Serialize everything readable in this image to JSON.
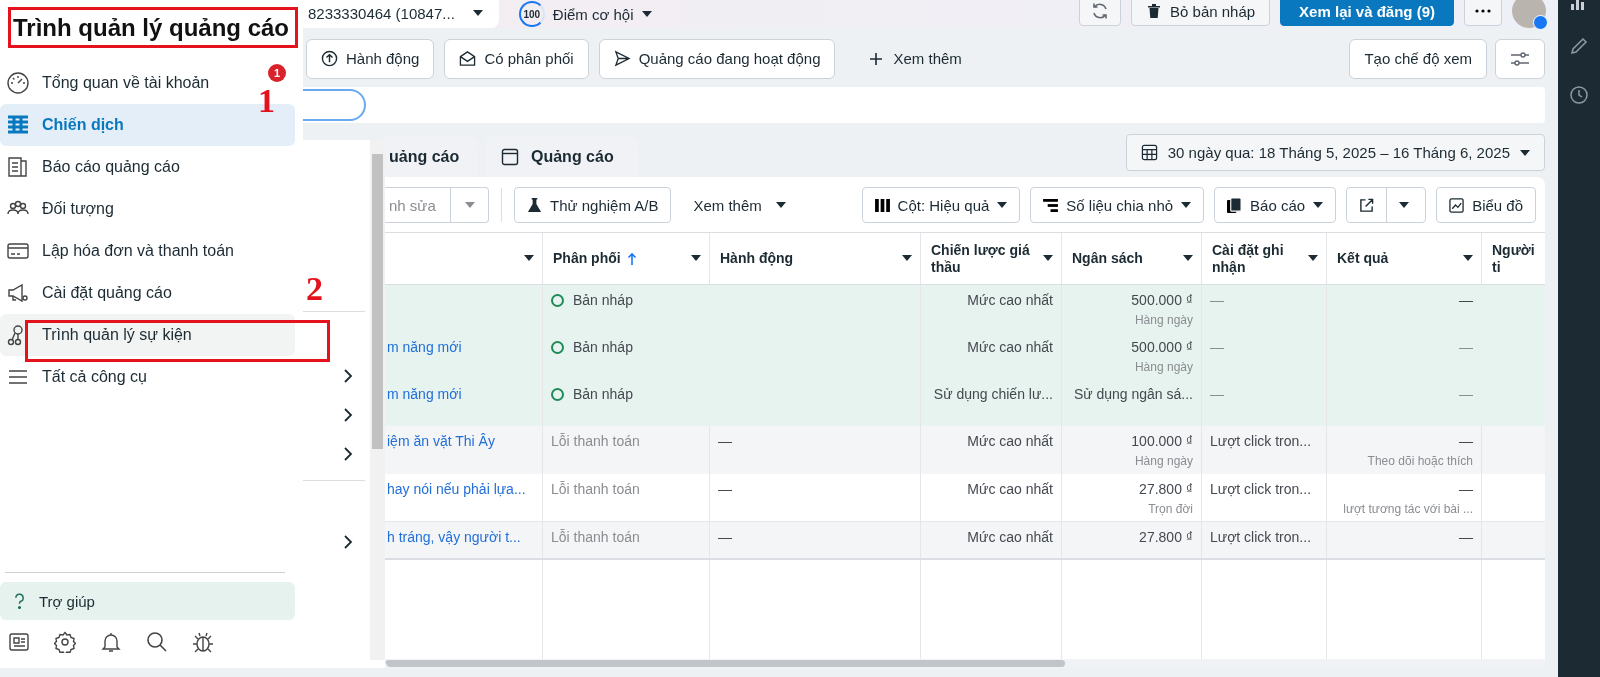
{
  "top_bar": {
    "account": "8233330464 (10847...",
    "score": "100",
    "opportunity": "Điểm cơ hội",
    "discard": "Bỏ bản nháp",
    "publish": "Xem lại và đăng (9)"
  },
  "filters": [
    {
      "label": "Hành động"
    },
    {
      "label": "Có phân phối"
    },
    {
      "label": "Quảng cáo đang hoạt động"
    }
  ],
  "more_filters": "Xem thêm",
  "create_view": "Tạo chế độ xem",
  "tabs": [
    {
      "label": "uảng cáo",
      "selected": false
    },
    {
      "label": "Quảng cáo",
      "selected": false
    }
  ],
  "date_range": "30 ngày qua: 18 Tháng 5, 2025 – 16 Tháng 6, 2025",
  "toolbar": {
    "edit": "nh sửa",
    "ab_test": "Thử nghiệm A/B",
    "more": "Xem thêm",
    "columns": "Cột: Hiệu quả",
    "breakdown": "Số liệu chia nhỏ",
    "reports": "Báo cáo",
    "chart": "Biểu đồ"
  },
  "table": {
    "columns": [
      {
        "sorted": false
      },
      {
        "label": "Phân phối",
        "sorted": true
      },
      {
        "label": "Hành động",
        "sorted": false
      },
      {
        "label": "Chiến lược giá thầu",
        "sorted": false
      },
      {
        "label": "Ngân sách",
        "sorted": false
      },
      {
        "label": "Cài đặt ghi nhận",
        "sorted": false
      },
      {
        "label": "Kết quả",
        "sorted": false
      },
      {
        "label": "Người ti",
        "sorted": false
      }
    ],
    "rows": [
      {
        "kind": "draft",
        "delivery": "Bản nháp",
        "bid": "Mức cao nhất",
        "budget": "500.000 ₫",
        "budget_sub": "Hàng ngày",
        "attribution": "—",
        "result": "—"
      },
      {
        "kind": "draft",
        "name": "m năng mới",
        "delivery": "Bản nháp",
        "bid": "Mức cao nhất",
        "budget": "500.000 ₫",
        "budget_sub": "Hàng ngày",
        "attribution": "—",
        "result": "—"
      },
      {
        "kind": "draft",
        "name": "m năng mới",
        "delivery": "Bản nháp",
        "bid": "Sử dụng chiến lư...",
        "budget": "Sử dụng ngân sá...",
        "attribution": "—",
        "result": "—"
      },
      {
        "kind": "error",
        "name": "iệm ăn vặt Thi Ây",
        "delivery": "Lỗi thanh toán",
        "action": "—",
        "bid": "Mức cao nhất",
        "budget": "100.000 ₫",
        "budget_sub": "Hàng ngày",
        "attribution": "Lượt click tron...",
        "result": "—",
        "result_sub": "Theo dõi hoặc thích"
      },
      {
        "kind": "error",
        "name": "hay nói nếu phải lựa...",
        "delivery": "Lỗi thanh toán",
        "action": "—",
        "bid": "Mức cao nhất",
        "budget": "27.800 ₫",
        "budget_sub": "Trọn đời",
        "attribution": "Lượt click tron...",
        "result": "—",
        "result_sub": "lượt tương tác với bài ..."
      },
      {
        "kind": "error",
        "name": "h tráng, vậy người t...",
        "delivery": "Lỗi thanh toán",
        "action": "—",
        "bid": "Mức cao nhất",
        "budget": "27.800 ₫",
        "attribution": "Lượt click tron...",
        "result": "—"
      }
    ]
  },
  "menu": {
    "title": "Trình quản lý quảng cáo",
    "title_highlighted": true,
    "items": [
      {
        "label": "Tổng quan về tài khoản",
        "selected": false,
        "hovered": false,
        "highlighted": false,
        "badge": "1"
      },
      {
        "label": "Chiến dịch",
        "selected": true,
        "hovered": false,
        "highlighted": false
      },
      {
        "label": "Báo cáo quảng cáo",
        "selected": false,
        "hovered": false,
        "highlighted": false
      },
      {
        "label": "Đối tượng",
        "selected": false,
        "hovered": false,
        "highlighted": false
      },
      {
        "label": "Lập hóa đơn và thanh toán",
        "selected": false,
        "hovered": false,
        "highlighted": false
      },
      {
        "label": "Cài đặt quảng cáo",
        "selected": false,
        "hovered": false,
        "highlighted": false
      },
      {
        "label": "Trình quản lý sự kiện",
        "selected": false,
        "hovered": true,
        "highlighted": true
      },
      {
        "label": "Tất cả công cụ",
        "selected": false,
        "hovered": false,
        "highlighted": false
      }
    ],
    "help": "Trợ giúp"
  },
  "annotations": [
    {
      "label": "1"
    },
    {
      "label": "2"
    }
  ]
}
